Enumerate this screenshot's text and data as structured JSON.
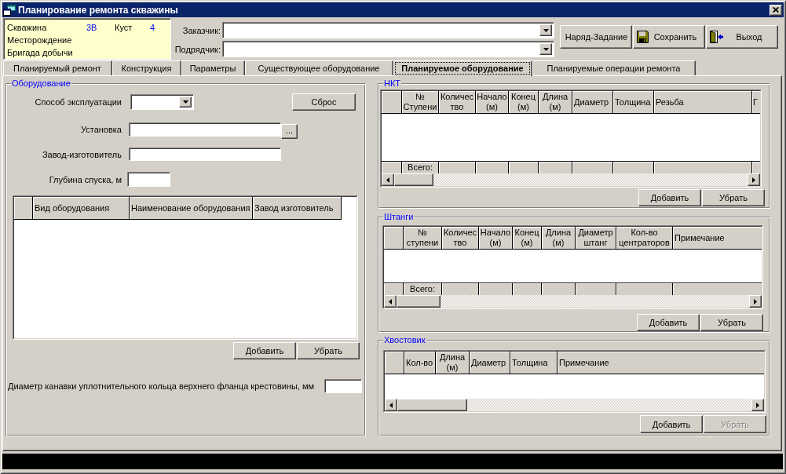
{
  "window": {
    "title": "Планирование ремонта скважины"
  },
  "well_info": {
    "well_label": "Скважина",
    "well_number": "3В",
    "cluster_label": "Куст",
    "cluster_number": "4",
    "oilfield_label": "Месторождение",
    "crew_label": "Бригада добычи"
  },
  "parties": [
    {
      "label": "Заказчик:"
    },
    {
      "label": "Подрядчик:"
    }
  ],
  "toolbar": [
    {
      "label": "Наряд-Задание",
      "kind": "plain"
    },
    {
      "label": "Сохранить",
      "kind": "save"
    },
    {
      "label": "Выход",
      "kind": "exit"
    }
  ],
  "tabs": [
    {
      "label": "Планируемый ремонт",
      "selected": false
    },
    {
      "label": "Конструкция",
      "selected": false
    },
    {
      "label": "Параметры",
      "selected": false
    },
    {
      "label": "Существующее оборудование",
      "selected": false
    },
    {
      "label": "Планируемое оборудование",
      "selected": true
    },
    {
      "label": "Планируемые операции ремонта",
      "selected": false
    }
  ],
  "equipment": {
    "title": "Оборудование",
    "operation_method_label": "Способ эксплуатации",
    "reset_button": "Сброс",
    "installation_label": "Установка",
    "browse_button": "...",
    "manufacturer_label": "Завод-изготовитель",
    "depth_label": "Глубина спуска, м",
    "table": {
      "columns": [
        "Вид оборудования",
        "Наименование оборудования",
        "Завод изготовитель"
      ]
    },
    "buttons": [
      {
        "label": "Добавить",
        "disabled": false
      },
      {
        "label": "Убрать",
        "disabled": false
      }
    ],
    "groove_diameter_label": "Диаметр канавки уплотнительного кольца верхнего фланца крестовины, мм"
  },
  "string_groups": [
    {
      "title": "НКТ",
      "table": {
        "columns": [
          "№\nСтупени",
          "Количес\nтво",
          "Начало\n(м)",
          "Конец\n(м)",
          "Длина\n(м)",
          "Диаметр",
          "Толщина",
          "Резьба",
          "Г"
        ],
        "footer_label": "Всего:"
      },
      "buttons": [
        {
          "label": "Добавить",
          "disabled": false
        },
        {
          "label": "Убрать",
          "disabled": false
        }
      ]
    },
    {
      "title": "Штанги",
      "table": {
        "columns": [
          "№\nступени",
          "Количес\nтво",
          "Начало\n(м)",
          "Конец\n(м)",
          "Длина\n(м)",
          "Диаметр\nштанг",
          "Кол-во\nцентраторов",
          "Примечание"
        ],
        "footer_label": "Всего:"
      },
      "buttons": [
        {
          "label": "Добавить",
          "disabled": false
        },
        {
          "label": "Убрать",
          "disabled": false
        }
      ]
    },
    {
      "title": "Хвостовик",
      "table": {
        "columns": [
          "Кол-во",
          "Длина\n(м)",
          "Диаметр",
          "Толщина",
          "Примечание"
        ]
      },
      "buttons": [
        {
          "label": "Добавить",
          "disabled": false
        },
        {
          "label": "Убрать",
          "disabled": true
        }
      ]
    }
  ]
}
